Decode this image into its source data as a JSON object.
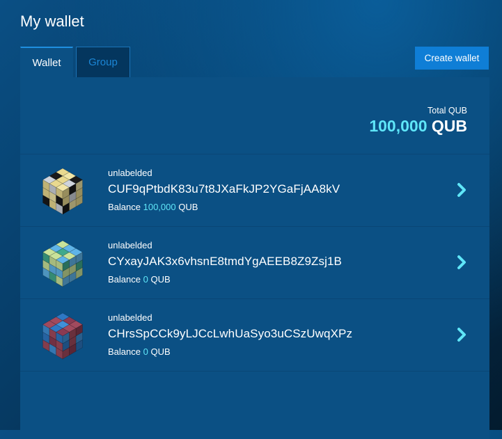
{
  "page": {
    "title": "My wallet"
  },
  "tabs": [
    {
      "label": "Wallet",
      "active": true
    },
    {
      "label": "Group",
      "active": false
    }
  ],
  "actions": {
    "create_wallet_label": "Create wallet"
  },
  "summary": {
    "label": "Total QUB",
    "amount": "100,000",
    "unit": "QUB"
  },
  "wallets": [
    {
      "label": "unlabelded",
      "address": "CUF9qPtbdK83u7t8JXaFkJP2YGaFjAA8kV",
      "balance_label": "Balance",
      "balance": "100,000",
      "unit": "QUB",
      "avatar_colors": [
        "#f2e6a6",
        "#1a1a1a",
        "#cfd4dc",
        "#e9d98f"
      ]
    },
    {
      "label": "unlabelded",
      "address": "CYxayJAK3x6vhsnE8tmdYgAEEB8Z9Zsj1B",
      "balance_label": "Balance",
      "balance": "0",
      "unit": "QUB",
      "avatar_colors": [
        "#5fb4e8",
        "#c9e39a",
        "#3fa98c",
        "#8fd3d0"
      ]
    },
    {
      "label": "unlabelded",
      "address": "CHrsSpCCk9yLJCcLwhUaSyo3uCSzUwqXPz",
      "balance_label": "Balance",
      "balance": "0",
      "unit": "QUB",
      "avatar_colors": [
        "#2e78c4",
        "#8a3a52",
        "#3f90d8",
        "#a14a5e"
      ]
    }
  ],
  "colors": {
    "accent": "#5fe6f8",
    "panel": "#0b5084",
    "button": "#0f7ed6"
  },
  "icons": {
    "row_action": "chevron-right-icon"
  }
}
